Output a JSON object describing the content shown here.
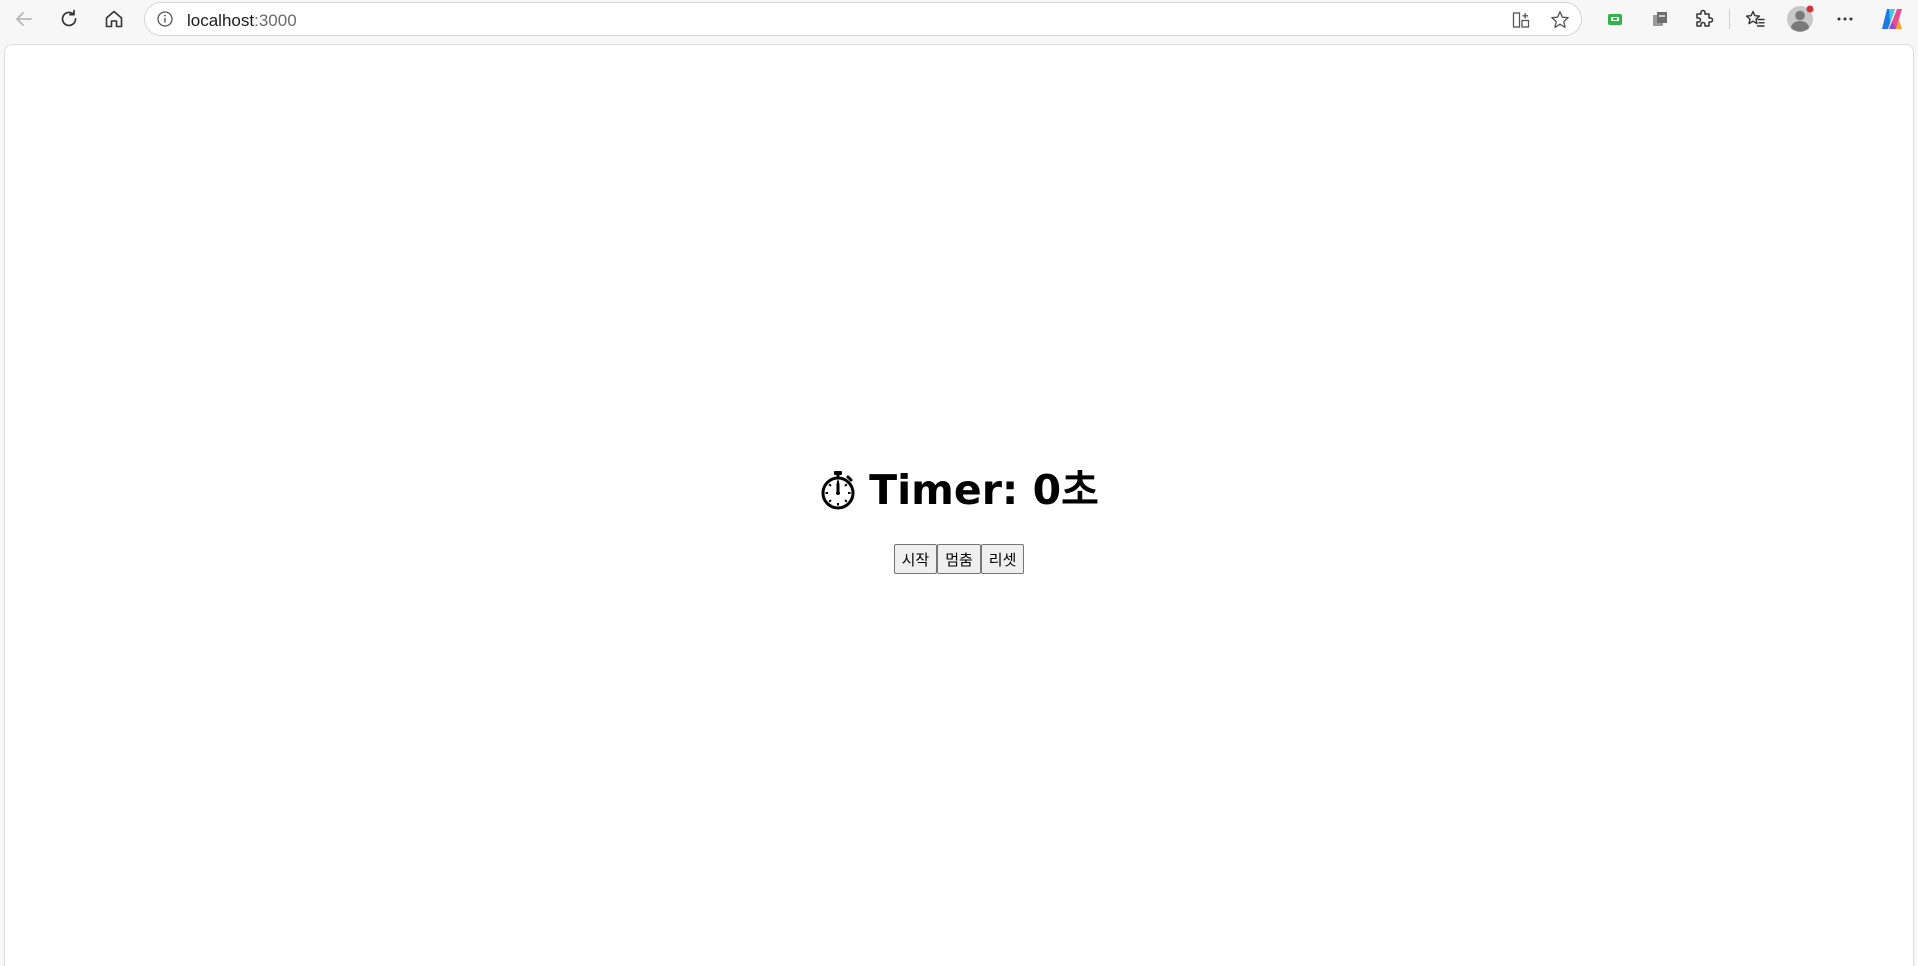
{
  "browser": {
    "url_host": "localhost",
    "url_port": ":3000",
    "icons": {
      "back": "back-arrow-icon",
      "refresh": "refresh-icon",
      "home": "home-icon",
      "site_info": "info-icon",
      "split_screen": "split-screen-icon",
      "favorite": "star-icon",
      "extension_green": "extension-icon",
      "collections": "collections-icon",
      "extensions": "puzzle-icon",
      "favorites_list": "favorites-list-icon",
      "profile": "avatar-icon",
      "more": "more-icon",
      "copilot": "copilot-icon"
    },
    "colors": {
      "toolbar_bg": "#f7f7f7",
      "notification_dot": "#d13438",
      "extension_green": "#2fb34a"
    }
  },
  "app": {
    "heading_prefix": "Timer: ",
    "seconds": "0",
    "unit": "초",
    "stopwatch_icon": "stopwatch-icon",
    "buttons": {
      "start": "시작",
      "stop": "멈춤",
      "reset": "리셋"
    }
  }
}
